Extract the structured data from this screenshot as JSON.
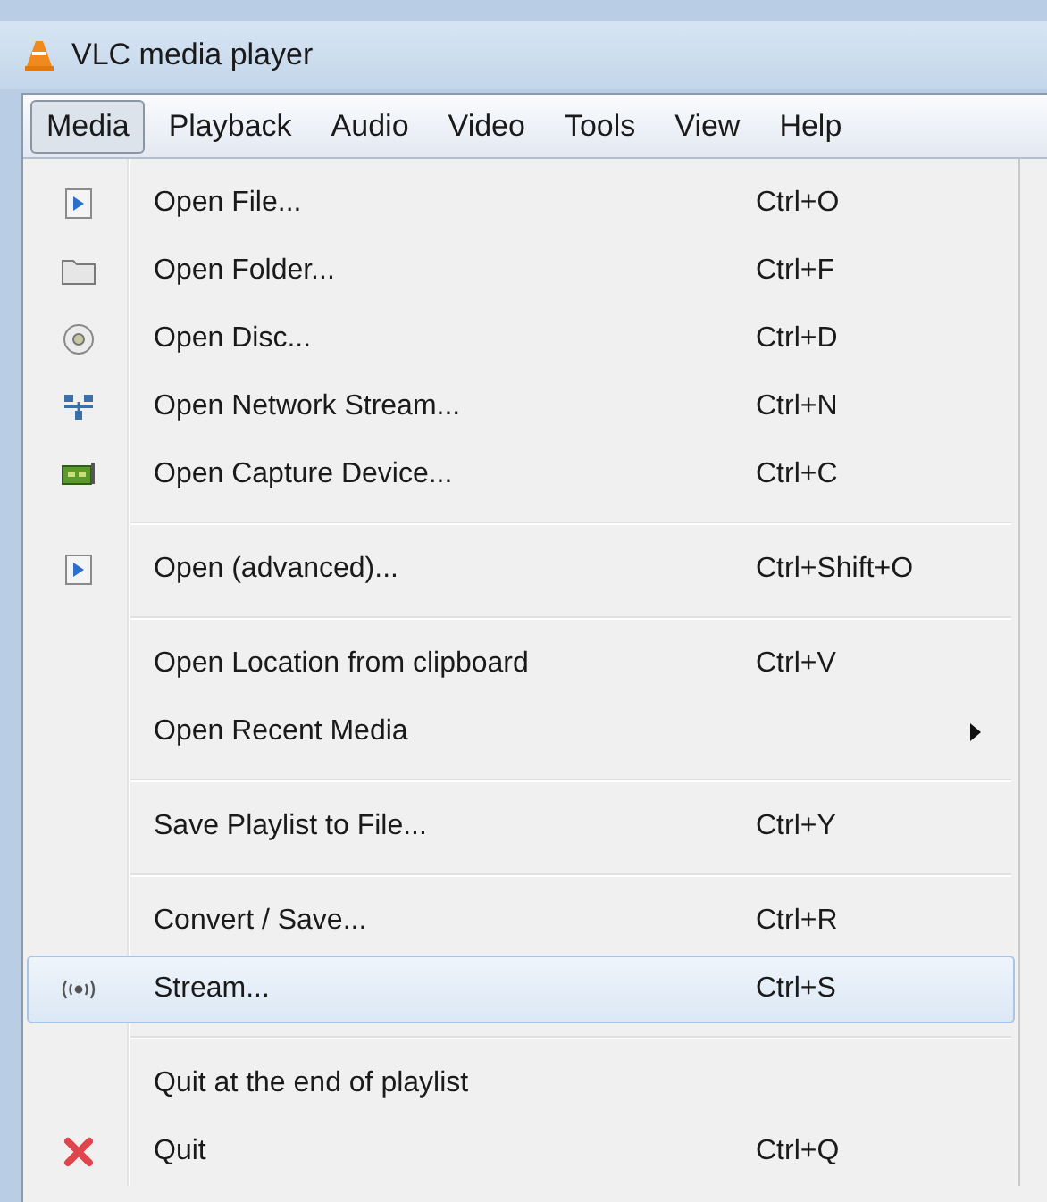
{
  "window": {
    "title": "VLC media player"
  },
  "menubar": [
    {
      "label": "Media",
      "selected": true
    },
    {
      "label": "Playback",
      "selected": false
    },
    {
      "label": "Audio",
      "selected": false
    },
    {
      "label": "Video",
      "selected": false
    },
    {
      "label": "Tools",
      "selected": false
    },
    {
      "label": "View",
      "selected": false
    },
    {
      "label": "Help",
      "selected": false
    }
  ],
  "menu": [
    {
      "kind": "item",
      "label": "Open File...",
      "shortcut": "Ctrl+O",
      "selected": false
    },
    {
      "kind": "item",
      "label": "Open Folder...",
      "shortcut": "Ctrl+F",
      "selected": false
    },
    {
      "kind": "item",
      "label": "Open Disc...",
      "shortcut": "Ctrl+D",
      "selected": false
    },
    {
      "kind": "item",
      "label": "Open Network Stream...",
      "shortcut": "Ctrl+N",
      "selected": false
    },
    {
      "kind": "item",
      "label": "Open Capture Device...",
      "shortcut": "Ctrl+C",
      "selected": false
    },
    {
      "kind": "separator"
    },
    {
      "kind": "item",
      "label": "Open (advanced)...",
      "shortcut": "Ctrl+Shift+O",
      "selected": false
    },
    {
      "kind": "separator"
    },
    {
      "kind": "item",
      "label": "Open Location from clipboard",
      "shortcut": "Ctrl+V",
      "selected": false
    },
    {
      "kind": "submenu",
      "label": "Open Recent Media",
      "selected": false
    },
    {
      "kind": "separator"
    },
    {
      "kind": "item",
      "label": "Save Playlist to File...",
      "shortcut": "Ctrl+Y",
      "selected": false
    },
    {
      "kind": "separator"
    },
    {
      "kind": "item",
      "label": "Convert / Save...",
      "shortcut": "Ctrl+R",
      "selected": false
    },
    {
      "kind": "item",
      "label": "Stream...",
      "shortcut": "Ctrl+S",
      "selected": true
    },
    {
      "kind": "separator"
    },
    {
      "kind": "item",
      "label": "Quit at the end of playlist",
      "selected": false
    },
    {
      "kind": "item",
      "label": "Quit",
      "shortcut": "Ctrl+Q",
      "selected": false
    }
  ]
}
